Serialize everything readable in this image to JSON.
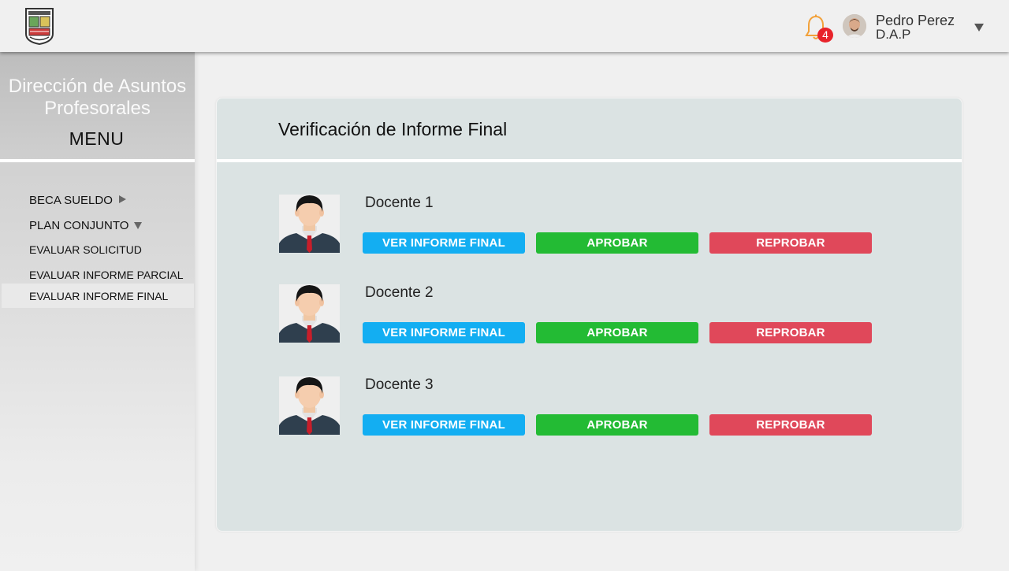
{
  "header": {
    "logo_icon": "university-crest-icon",
    "notification_icon": "bell-icon",
    "notification_count": "4",
    "user_name": "Pedro Perez",
    "user_role": "D.A.P",
    "user_menu_icon": "caret-down-icon"
  },
  "sidebar": {
    "title": "Dirección de Asuntos Profesorales",
    "menu_label": "MENU",
    "items": [
      {
        "label": "BECA SUELDO",
        "icon": "arrow-right-icon"
      },
      {
        "label": "PLAN CONJUNTO",
        "icon": "arrow-down-icon"
      },
      {
        "label": "EVALUAR SOLICITUD"
      },
      {
        "label": "EVALUAR INFORME PARCIAL"
      },
      {
        "label": "EVALUAR INFORME FINAL",
        "active": true
      }
    ]
  },
  "main": {
    "title": "Verificación de Informe Final",
    "docentes": [
      {
        "name": "Docente 1",
        "ver_label": "VER INFORME FINAL",
        "aprobar_label": "APROBAR",
        "reprobar_label": "REPROBAR"
      },
      {
        "name": "Docente 2",
        "ver_label": "VER INFORME FINAL",
        "aprobar_label": "APROBAR",
        "reprobar_label": "REPROBAR"
      },
      {
        "name": "Docente 3",
        "ver_label": "VER INFORME FINAL",
        "aprobar_label": "APROBAR",
        "reprobar_label": "REPROBAR"
      }
    ]
  },
  "colors": {
    "ver_button": "#13aef2",
    "aprobar_button": "#23bb34",
    "reprobar_button": "#e0485a",
    "badge": "#e8232a",
    "card_background": "#dbe3e3"
  }
}
